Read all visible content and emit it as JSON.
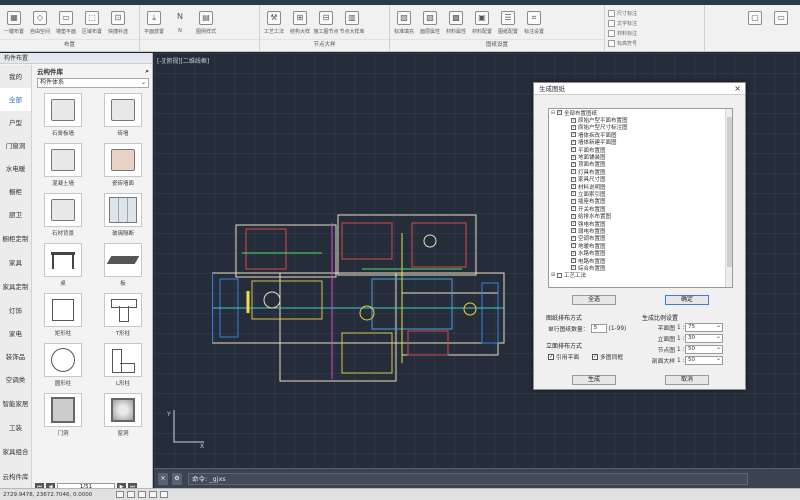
{
  "ribbon": {
    "groups": [
      {
        "name": "布置",
        "buttons": [
          "一键布置",
          "自由空间",
          "墙垫平面",
          "区域布置",
          "快捷补选"
        ]
      },
      {
        "name": "",
        "buttons": [
          "平面放置",
          "N",
          "图例样式"
        ]
      },
      {
        "name": "节点大样",
        "buttons": [
          "工艺工法",
          "结构大样",
          "施工图节点",
          "节点大样库"
        ]
      },
      {
        "name": "图纸设置",
        "buttons": [
          "标准填充",
          "面层属性",
          "材料属性",
          "材料配置",
          "图纸配置",
          "标注设置"
        ]
      }
    ],
    "small_tools": [
      "尺寸标注",
      "文字标注",
      "材料标注",
      "标高符号"
    ]
  },
  "left_panel": {
    "title": "构件布置",
    "categories": [
      "我的",
      "全部",
      "户型",
      "门窗洞",
      "水电暖",
      "橱柜",
      "厨卫",
      "橱柜定制",
      "家具",
      "家具定制",
      "灯饰",
      "家电",
      "装饰品",
      "空调类",
      "智能家居",
      "工装",
      "家具组合",
      "云构件库"
    ],
    "library_title": "云构件库",
    "library_select": "构件体系",
    "items": [
      {
        "name": "石膏板墙",
        "thumb": "box"
      },
      {
        "name": "砖墙",
        "thumb": "box"
      },
      {
        "name": "混凝土墙",
        "thumb": "box"
      },
      {
        "name": "瓷砖墙面",
        "thumb": "warm"
      },
      {
        "name": "石材背景",
        "thumb": "box"
      },
      {
        "name": "玻璃隔断",
        "thumb": "glass"
      },
      {
        "name": "桌",
        "thumb": "table"
      },
      {
        "name": "板",
        "thumb": "plate"
      },
      {
        "name": "矩形柱",
        "thumb": "square"
      },
      {
        "name": "T形柱",
        "thumb": "T"
      },
      {
        "name": "圆形柱",
        "thumb": "circle"
      },
      {
        "name": "L形柱",
        "thumb": "L"
      },
      {
        "name": "门洞",
        "thumb": "door"
      },
      {
        "name": "窗洞",
        "thumb": "pane"
      }
    ],
    "page": "1/51"
  },
  "canvas": {
    "view_label": "[-][俯视][二维线框]"
  },
  "command_line": {
    "text": "命令: _gjxs"
  },
  "statusbar": {
    "coords": "2729.9478, 23672.7046, 0.0000"
  },
  "dialog": {
    "title": "生成图纸",
    "close": "×",
    "tree": {
      "root": "全部布置图纸",
      "children": [
        "原始户型平面布置图",
        "原始户型尺寸标注图",
        "墙体拆改平面图",
        "墙体新建平面图",
        "平面布置图",
        "地面铺装图",
        "顶面布置图",
        "灯具布置图",
        "家具尺寸图",
        "材料说明图",
        "立面索引图",
        "插座布置图",
        "开关布置图",
        "给排水布置图",
        "强电布置图",
        "弱电布置图",
        "空调布置图",
        "地暖布置图",
        "水路布置图",
        "电路布置图",
        "综合布置图"
      ],
      "root2": "工艺工法"
    },
    "btn_all": "全选",
    "btn_ok": "确定",
    "layout_title": "图纸排布方式",
    "per_row_label": "单行图纸数量：",
    "per_row_value": "5",
    "per_row_range": "(1-99)",
    "elev_title": "立面排布方式",
    "cb1": "引用平面",
    "cb2": "多图同框",
    "scale_title": "生成比例设置",
    "scales": [
      {
        "label": "平面图",
        "prefix": "1 :",
        "value": "75"
      },
      {
        "label": "立面图",
        "prefix": "1 :",
        "value": "30"
      },
      {
        "label": "节点图",
        "prefix": "1 :",
        "value": "50"
      },
      {
        "label": "剖面大样",
        "prefix": "1 :",
        "value": "50"
      }
    ],
    "btn_generate": "生成",
    "btn_cancel": "取消"
  }
}
